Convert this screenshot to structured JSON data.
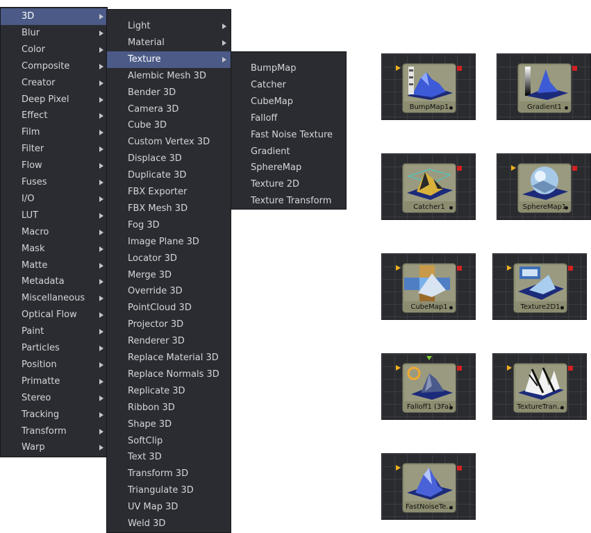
{
  "menu_level1": {
    "items": [
      "3D",
      "Blur",
      "Color",
      "Composite",
      "Creator",
      "Deep Pixel",
      "Effect",
      "Film",
      "Filter",
      "Flow",
      "Fuses",
      "I/O",
      "LUT",
      "Macro",
      "Mask",
      "Matte",
      "Metadata",
      "Miscellaneous",
      "Optical Flow",
      "Paint",
      "Particles",
      "Position",
      "Primatte",
      "Stereo",
      "Tracking",
      "Transform",
      "Warp"
    ],
    "highlighted": "3D"
  },
  "menu_3d": {
    "items": [
      "Light",
      "Material",
      "Texture",
      "Alembic Mesh 3D",
      "Bender 3D",
      "Camera 3D",
      "Cube 3D",
      "Custom Vertex 3D",
      "Displace 3D",
      "Duplicate 3D",
      "FBX Exporter",
      "FBX Mesh 3D",
      "Fog 3D",
      "Image Plane 3D",
      "Locator 3D",
      "Merge 3D",
      "Override 3D",
      "PointCloud 3D",
      "Projector 3D",
      "Renderer 3D",
      "Replace Material 3D",
      "Replace Normals 3D",
      "Replicate 3D",
      "Ribbon 3D",
      "Shape 3D",
      "SoftClip",
      "Text 3D",
      "Transform 3D",
      "Triangulate 3D",
      "UV Map 3D",
      "Weld 3D"
    ],
    "submenus": [
      "Light",
      "Material",
      "Texture"
    ],
    "highlighted": "Texture"
  },
  "menu_texture": {
    "items": [
      "BumpMap",
      "Catcher",
      "CubeMap",
      "Falloff",
      "Fast Noise Texture",
      "Gradient",
      "SphereMap",
      "Texture 2D",
      "Texture Transform"
    ]
  },
  "nodes": [
    {
      "label": "BumpMap1",
      "icon": "bumpmap-thumbnail-icon",
      "input": true
    },
    {
      "label": "Gradient1",
      "icon": "gradient-thumbnail-icon",
      "input": false
    },
    {
      "label": "Catcher1",
      "icon": "catcher-thumbnail-icon",
      "input": false
    },
    {
      "label": "SphereMap1",
      "icon": "spheremap-thumbnail-icon",
      "input": true
    },
    {
      "label": "CubeMap1",
      "icon": "cubemap-thumbnail-icon",
      "input": true
    },
    {
      "label": "Texture2D1",
      "icon": "texture2d-thumbnail-icon",
      "input": true
    },
    {
      "label": "Falloff1  (3Fa)",
      "icon": "falloff-thumbnail-icon",
      "input": true
    },
    {
      "label": "TextureTran...",
      "icon": "texturetransform-thumbnail-icon",
      "input": true
    },
    {
      "label": "FastNoiseTe...",
      "icon": "fastnoise-thumbnail-icon",
      "input": true
    }
  ],
  "colors": {
    "menu_bg": "#2b2c31",
    "menu_highlight": "#4b5a86",
    "menu_text": "#d4d6da",
    "node_tile": "#8c8c70",
    "input_port": "#f0b21c",
    "output_port": "#d42020",
    "effect_port": "#7ecf3a"
  }
}
